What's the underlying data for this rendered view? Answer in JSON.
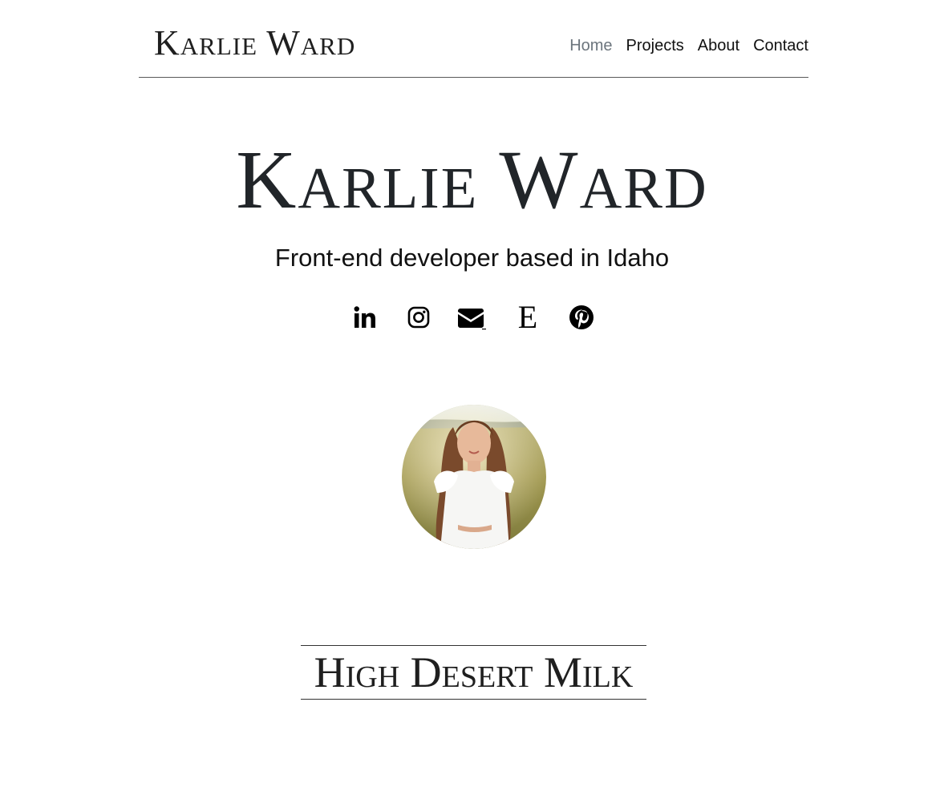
{
  "header": {
    "brand": "Karlie Ward",
    "nav": [
      {
        "label": "Home",
        "active": true
      },
      {
        "label": "Projects",
        "active": false
      },
      {
        "label": "About",
        "active": false
      },
      {
        "label": "Contact",
        "active": false
      }
    ]
  },
  "hero": {
    "title": "Karlie Ward",
    "tagline": "Front-end developer based in Idaho"
  },
  "socials": [
    {
      "icon": "linkedin-icon"
    },
    {
      "icon": "instagram-icon"
    },
    {
      "icon": "email-icon"
    },
    {
      "icon": "etsy-icon",
      "glyph": "E"
    },
    {
      "icon": "pinterest-icon"
    }
  ],
  "section": {
    "title": "High Desert Milk"
  },
  "colors": {
    "text": "#212529",
    "nav_active": "#6c757d",
    "divider": "#5a5a5a"
  }
}
